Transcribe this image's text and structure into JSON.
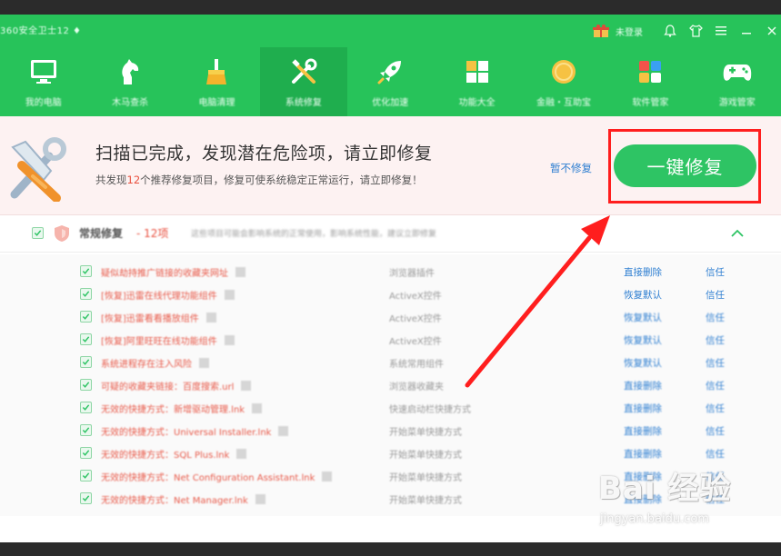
{
  "app": {
    "title": "360安全卫士12 ♦",
    "login": "未登录"
  },
  "nav": {
    "items": [
      {
        "label": "我的电脑",
        "icon": "monitor-icon"
      },
      {
        "label": "木马查杀",
        "icon": "horse-icon"
      },
      {
        "label": "电脑清理",
        "icon": "broom-icon"
      },
      {
        "label": "系统修复",
        "icon": "tools-icon"
      },
      {
        "label": "优化加速",
        "icon": "rocket-icon"
      },
      {
        "label": "功能大全",
        "icon": "grid-icon"
      },
      {
        "label": "金融・互助宝",
        "icon": "coin-icon"
      },
      {
        "label": "软件管家",
        "icon": "apps-icon"
      },
      {
        "label": "游戏管家",
        "icon": "gamepad-icon"
      }
    ],
    "active_index": 3
  },
  "banner": {
    "title": "扫描已完成，发现潜在危险项，请立即修复",
    "subtitle_prefix": "共发现",
    "subtitle_count": "12",
    "subtitle_suffix": "个推荐修复项目，修复可使系统稳定正常运行，请立即修复！",
    "later_link": "暂不修复",
    "fix_button": "一键修复"
  },
  "category": {
    "label": "常规修复",
    "count": "- 12项",
    "description": "这些项目可能会影响系统的正常使用，影响系统性能，建议立即修复"
  },
  "items": [
    {
      "name": "疑似劫持推广链接的收藏夹网址",
      "type": "浏览器插件",
      "action1": "直接删除",
      "action2": "信任"
    },
    {
      "name": "[恢复]迅雷在线代理功能组件",
      "type": "ActiveX控件",
      "action1": "恢复默认",
      "action2": "信任"
    },
    {
      "name": "[恢复]迅雷看看播放组件",
      "type": "ActiveX控件",
      "action1": "恢复默认",
      "action2": "信任"
    },
    {
      "name": "[恢复]阿里旺旺在线功能组件",
      "type": "ActiveX控件",
      "action1": "恢复默认",
      "action2": "信任"
    },
    {
      "name": "系统进程存在注入风险",
      "type": "系统常用组件",
      "action1": "恢复默认",
      "action2": "信任"
    },
    {
      "name": "可疑的收藏夹链接：百度搜索.url",
      "type": "浏览器收藏夹",
      "action1": "直接删除",
      "action2": "信任"
    },
    {
      "name": "无效的快捷方式：新增驱动管理.lnk",
      "type": "快速启动栏快捷方式",
      "action1": "直接删除",
      "action2": "信任"
    },
    {
      "name": "无效的快捷方式：Universal Installer.lnk",
      "type": "开始菜单快捷方式",
      "action1": "直接删除",
      "action2": "信任"
    },
    {
      "name": "无效的快捷方式：SQL Plus.lnk",
      "type": "开始菜单快捷方式",
      "action1": "直接删除",
      "action2": "信任"
    },
    {
      "name": "无效的快捷方式：Net Configuration Assistant.lnk",
      "type": "开始菜单快捷方式",
      "action1": "直接删除",
      "action2": "信任"
    },
    {
      "name": "无效的快捷方式：Net Manager.lnk",
      "type": "开始菜单快捷方式",
      "action1": "直接删除",
      "action2": "信任"
    }
  ],
  "watermark": {
    "logo": "Bai 经验",
    "url": "jingyan.baidu.com"
  },
  "colors": {
    "brand_green": "#27c35a",
    "annotation_red": "#ff1e1e",
    "link_blue": "#2f7fd1",
    "danger_red": "#e9503f"
  }
}
